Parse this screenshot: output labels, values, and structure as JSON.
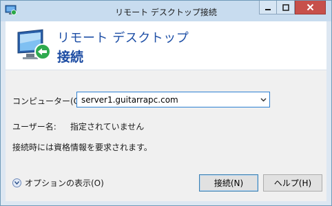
{
  "window": {
    "title": "リモート デスクトップ接続",
    "buttons": {
      "minimize": "minimize-icon",
      "maximize": "maximize-icon",
      "close": "close-icon"
    },
    "colors": {
      "close": "#c7504b",
      "accent": "#1e4fa6"
    }
  },
  "header": {
    "subtitle": "リモート デスクトップ",
    "title": "接続"
  },
  "form": {
    "computer_label": "コンピューター(C):",
    "computer_value": "server1.guitarrapc.com",
    "user_label": "ユーザー名:",
    "user_value": "指定されていません",
    "credential_note": "接続時には資格情報を要求されます。"
  },
  "footer": {
    "options_label": "オプションの表示(O)",
    "connect_label": "接続(N)",
    "help_label": "ヘルプ(H)"
  }
}
